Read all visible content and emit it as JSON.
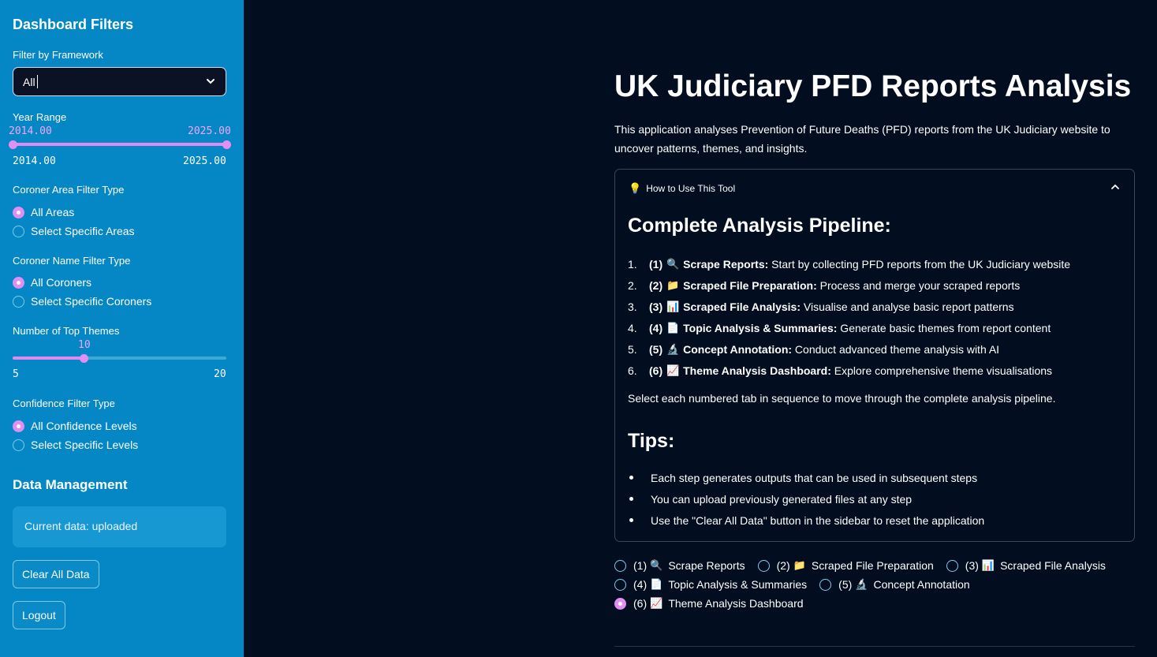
{
  "sidebar": {
    "title": "Dashboard Filters",
    "framework": {
      "label": "Filter by Framework",
      "value": "All"
    },
    "year_range": {
      "label": "Year Range",
      "low": "2014.00",
      "high": "2025.00",
      "min": "2014.00",
      "max": "2025.00"
    },
    "coroner_area": {
      "label": "Coroner Area Filter Type",
      "options": [
        "All Areas",
        "Select Specific Areas"
      ],
      "selected": 0
    },
    "coroner_name": {
      "label": "Coroner Name Filter Type",
      "options": [
        "All Coroners",
        "Select Specific Coroners"
      ],
      "selected": 0
    },
    "top_themes": {
      "label": "Number of Top Themes",
      "value": "10",
      "min": "5",
      "max": "20",
      "fraction": 0.3333
    },
    "confidence": {
      "label": "Confidence Filter Type",
      "options": [
        "All Confidence Levels",
        "Select Specific Levels"
      ],
      "selected": 0
    },
    "data_management": {
      "title": "Data Management",
      "current": "Current data: uploaded",
      "clear_label": "Clear All Data",
      "logout_label": "Logout"
    }
  },
  "main": {
    "title": "UK Judiciary PFD Reports Analysis",
    "intro": "This application analyses Prevention of Future Deaths (PFD) reports from the UK Judiciary website to uncover patterns, themes, and insights.",
    "expander": {
      "title": "How to Use This Tool",
      "pipeline_heading": "Complete Analysis Pipeline:",
      "steps": [
        {
          "n": "1.",
          "tag": "(1)",
          "icon": "magnifier-icon",
          "name": "Scrape Reports:",
          "desc": " Start by collecting PFD reports from the UK Judiciary website"
        },
        {
          "n": "2.",
          "tag": "(2)",
          "icon": "folder-icon",
          "name": "Scraped File Preparation:",
          "desc": " Process and merge your scraped reports"
        },
        {
          "n": "3.",
          "tag": "(3)",
          "icon": "bar-chart-icon",
          "name": "Scraped File Analysis:",
          "desc": " Visualise and analyse basic report patterns"
        },
        {
          "n": "4.",
          "tag": "(4)",
          "icon": "document-icon",
          "name": "Topic Analysis & Summaries:",
          "desc": " Generate basic themes from report content"
        },
        {
          "n": "5.",
          "tag": "(5)",
          "icon": "microscope-icon",
          "name": "Concept Annotation:",
          "desc": " Conduct advanced theme analysis with AI"
        },
        {
          "n": "6.",
          "tag": "(6)",
          "icon": "trend-chart-icon",
          "name": "Theme Analysis Dashboard:",
          "desc": " Explore comprehensive theme visualisations"
        }
      ],
      "pipeline_note": "Select each numbered tab in sequence to move through the complete analysis pipeline.",
      "tips_heading": "Tips:",
      "tips": [
        "Each step generates outputs that can be used in subsequent steps",
        "You can upload previously generated files at any step",
        "Use the \"Clear All Data\" button in the sidebar to reset the application"
      ]
    },
    "tabs": [
      {
        "tag": "(1)",
        "label": "Scrape Reports"
      },
      {
        "tag": "(2)",
        "label": "Scraped File Preparation"
      },
      {
        "tag": "(3)",
        "label": "Scraped File Analysis"
      },
      {
        "tag": "(4)",
        "label": "Topic Analysis & Summaries"
      },
      {
        "tag": "(5)",
        "label": "Concept Annotation"
      },
      {
        "tag": "(6)",
        "label": "Theme Analysis Dashboard"
      }
    ],
    "selected_tab": 5
  },
  "colors": {
    "sidebar_bg": "#0487c4",
    "main_bg": "#020e1f",
    "accent": "#e08ef5"
  }
}
